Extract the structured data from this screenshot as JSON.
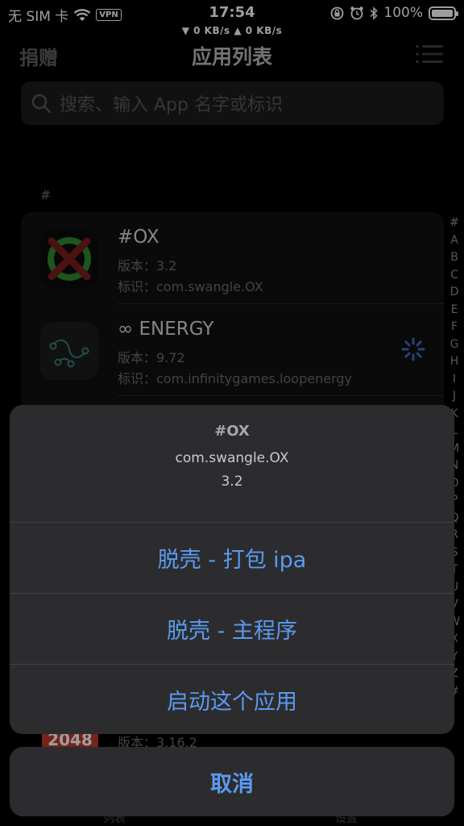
{
  "status": {
    "carrier": "无 SIM 卡",
    "vpn": "VPN",
    "time": "17:54",
    "speed": "▼ 0 KB/s    ▲ 0 KB/s",
    "battery": "100%"
  },
  "nav": {
    "donate": "捐赠",
    "title": "应用列表"
  },
  "search": {
    "placeholder": "搜索、输入 App 名字或标识"
  },
  "section": "#",
  "apps": [
    {
      "name": "#OX",
      "version": "版本：3.2",
      "bundle": "标识：com.swangle.OX",
      "icon": "ox-icon"
    },
    {
      "name": "∞ ENERGY",
      "version": "版本：9.72",
      "bundle": "标识：com.infinitygames.loopenergy",
      "icon": "energy-icon"
    }
  ],
  "index": [
    "#",
    "A",
    "B",
    "C",
    "D",
    "E",
    "F",
    "G",
    "H",
    "I",
    "J",
    "K",
    "L",
    "M",
    "N",
    "O",
    "P",
    "Q",
    "R",
    "S",
    "T",
    "U",
    "V",
    "W",
    "X",
    "Y",
    "Z",
    "#"
  ],
  "peek": {
    "badge": "2048",
    "version": "版本：3.16.2"
  },
  "tabs": {
    "list": "列表",
    "settings": "设置"
  },
  "sheet": {
    "title": "#OX",
    "bundle": "com.swangle.OX",
    "version": "3.2",
    "actions": [
      "脱壳 - 打包 ipa",
      "脱壳 - 主程序",
      "启动这个应用"
    ],
    "cancel": "取消"
  },
  "colors": {
    "accent": "#5a9bef",
    "sheet_bg": "#2c2c2e"
  }
}
